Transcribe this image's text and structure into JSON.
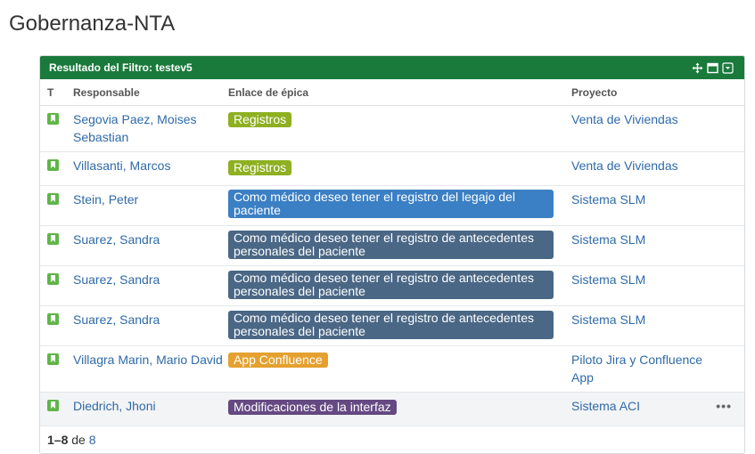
{
  "page": {
    "title": "Gobernanza-NTA"
  },
  "gadget": {
    "title": "Resultado del Filtro: testev5",
    "columns": {
      "type": "T",
      "responsible": "Responsable",
      "epic": "Enlace de épica",
      "project": "Proyecto"
    },
    "colors": {
      "header_bg": "#1a7a3c",
      "type_icon": "#5fb548"
    },
    "rows": [
      {
        "type_icon": "story-icon",
        "responsible": "Segovia Paez, Moises Sebastian",
        "epic": "Registros",
        "epic_color": "#8eb021",
        "project": "Venta de Viviendas"
      },
      {
        "type_icon": "story-icon",
        "responsible": "Villasanti, Marcos",
        "epic": "Registros",
        "epic_color": "#8eb021",
        "project": "Venta de Viviendas"
      },
      {
        "type_icon": "story-icon",
        "responsible": "Stein, Peter",
        "epic": "Como médico deseo tener el registro del legajo del paciente",
        "epic_color": "#3b7fc4",
        "project": "Sistema SLM"
      },
      {
        "type_icon": "story-icon",
        "responsible": "Suarez, Sandra",
        "epic": "Como médico deseo tener el registro de antecedentes personales del paciente",
        "epic_color": "#4a6785",
        "project": "Sistema SLM"
      },
      {
        "type_icon": "story-icon",
        "responsible": "Suarez, Sandra",
        "epic": "Como médico deseo tener el registro de antecedentes personales del paciente",
        "epic_color": "#4a6785",
        "project": "Sistema SLM"
      },
      {
        "type_icon": "story-icon",
        "responsible": "Suarez, Sandra",
        "epic": "Como médico deseo tener el registro de antecedentes personales del paciente",
        "epic_color": "#4a6785",
        "project": "Sistema SLM"
      },
      {
        "type_icon": "story-icon",
        "responsible": "Villagra Marin, Mario David",
        "epic": "App Confluence",
        "epic_color": "#e4a130",
        "project": "Piloto Jira y Confluence App"
      },
      {
        "type_icon": "story-icon",
        "responsible": "Diedrich, Jhoni",
        "epic": "Modificaciones de la interfaz",
        "epic_color": "#654982",
        "project": "Sistema ACI",
        "more": "•••"
      }
    ],
    "footer": {
      "range": "1–8",
      "of": "de",
      "total": "8"
    }
  }
}
